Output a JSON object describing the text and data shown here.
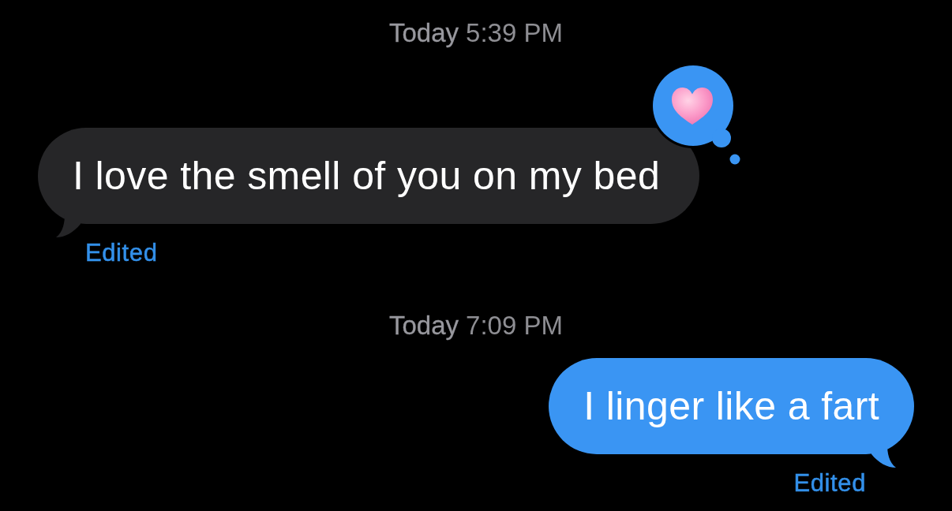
{
  "conversation": [
    {
      "kind": "timestamp",
      "day": "Today",
      "time": "5:39 PM"
    },
    {
      "kind": "received",
      "text": "I love the smell of you on my bed",
      "tapback": true,
      "edited": "Edited"
    },
    {
      "kind": "timestamp",
      "day": "Today",
      "time": "7:09 PM"
    },
    {
      "kind": "sent",
      "text": "I linger like a fart",
      "edited": "Edited"
    }
  ]
}
